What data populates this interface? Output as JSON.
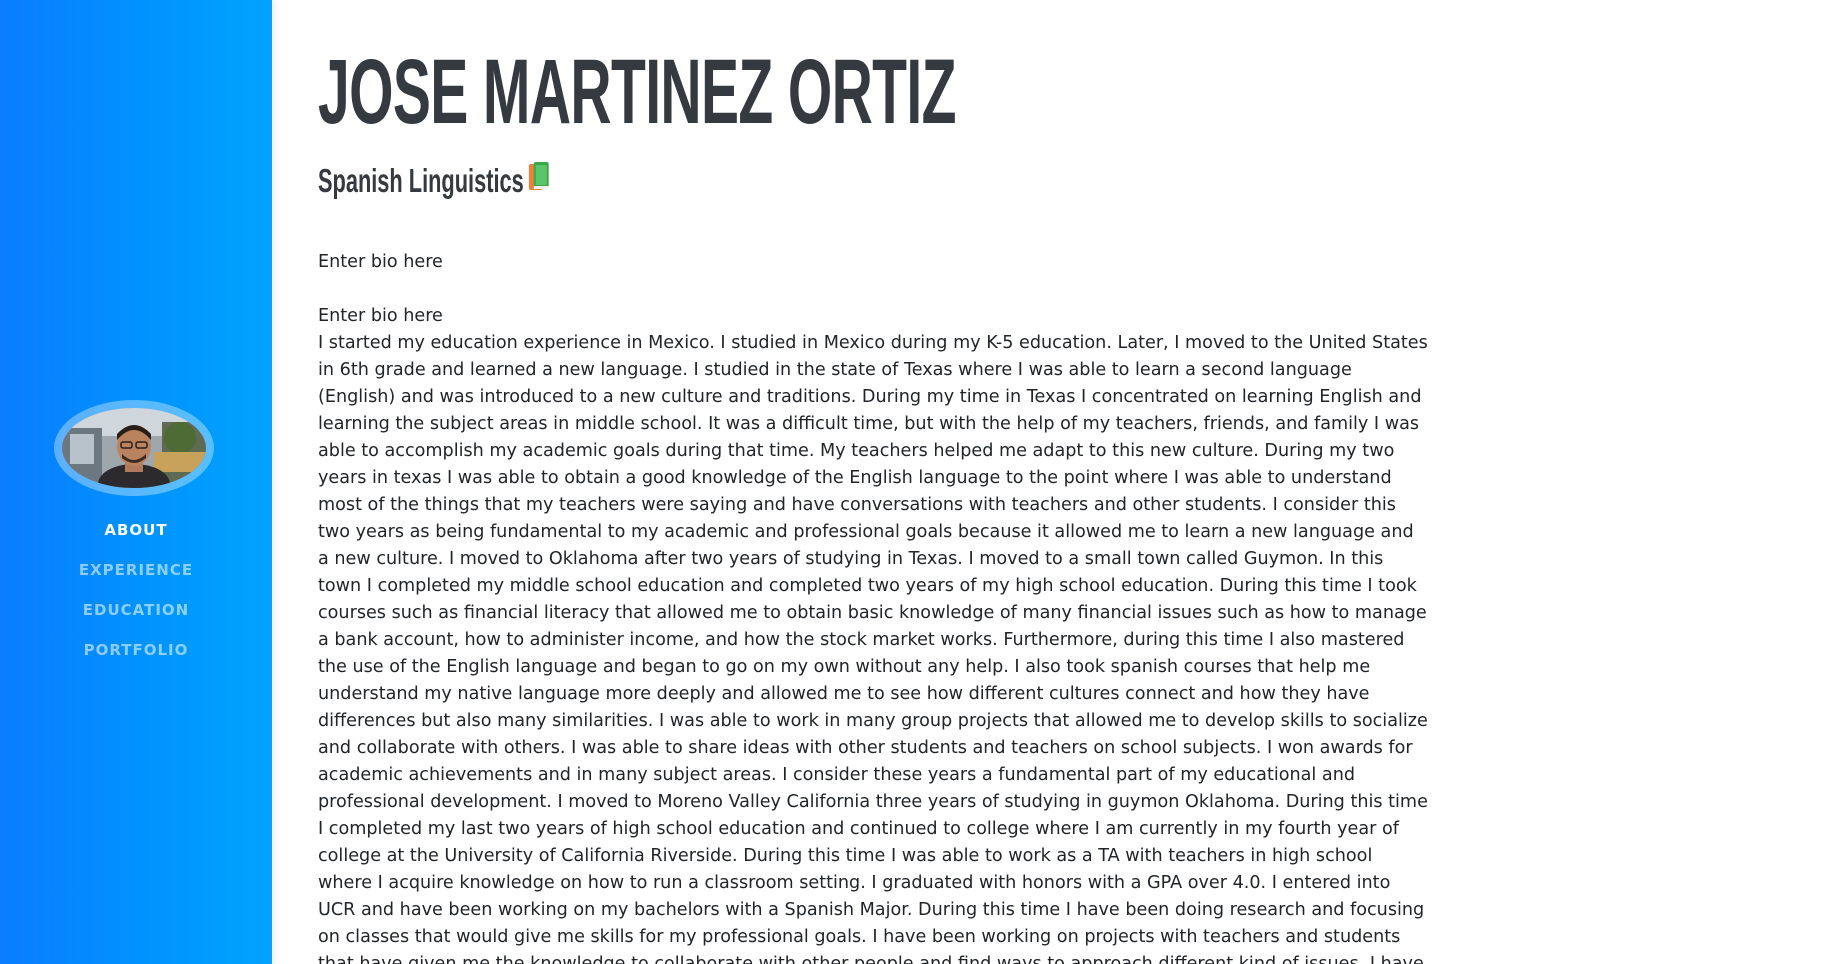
{
  "profile": {
    "name": "Jose Martinez Ortiz",
    "subtitle": "Spanish Linguistics",
    "subtitle_icon": "books-icon"
  },
  "nav": {
    "items": [
      {
        "label": "About",
        "active": true
      },
      {
        "label": "Experience",
        "active": false
      },
      {
        "label": "Education",
        "active": false
      },
      {
        "label": "Portfolio",
        "active": false
      }
    ]
  },
  "bio": {
    "line1": "Enter bio here",
    "line2": "Enter bio here",
    "body": "I started my education experience in Mexico. I studied in Mexico during my K-5 education. Later, I moved to the United States in 6th grade and learned a new language. I studied in the state of Texas where I was able to learn a second language (English) and was introduced to a new culture and traditions. During my time in Texas I concentrated on learning English and learning the subject areas in middle school. It was a difficult time, but with the help of my teachers, friends, and family I was able to accomplish my academic goals during that time. My teachers helped me adapt to this new culture. During my two years in texas I was able to obtain a good knowledge of the English language to the point where I was able to understand most of the things that my teachers were saying and have conversations with teachers and other students. I consider this two years as being fundamental to my academic and professional goals because it allowed me to learn a new language and a new culture. I moved to Oklahoma after two years of studying in Texas. I moved to a small town called Guymon. In this town I completed my middle school education and completed two years of my high school education. During this time I took courses such as financial literacy that allowed me to obtain basic knowledge of many financial issues such as how to manage a bank account, how to administer income, and how the stock market works. Furthermore, during this time I also mastered the use of the English language and began to go on my own without any help. I also took spanish courses that help me understand my native language more deeply and allowed me to see how different cultures connect and how they have differences but also many similarities. I was able to work in many group projects that allowed me to develop skills to socialize and collaborate with others. I was able to share ideas with other students and teachers on school subjects. I won awards for academic achievements and in many subject areas. I consider these years a fundamental part of my educational and professional development. I moved to Moreno Valley California three years of studying in guymon Oklahoma. During this time I completed my last two years of high school education and continued to college where I am currently in my fourth year of college at the University of California Riverside. During this time I was able to work as a TA with teachers in high school where I acquire knowledge on how to run a classroom setting. I graduated with honors with a GPA over 4.0. I entered into UCR and have been working on my bachelors with a Spanish Major. During this time I have been doing research and focusing on classes that would give me skills for my professional goals. I have been working on projects with teachers and students that have given me the knowledge to collaborate with other people and find ways to approach different kind of issues. I have been taking a variety of classes that are preparing me for life after college and that have given me experience in subjects"
  },
  "colors": {
    "sidebar_left": "#0a7cff",
    "sidebar_right": "#00a3fd",
    "heading": "#343a40",
    "text": "#212529"
  }
}
